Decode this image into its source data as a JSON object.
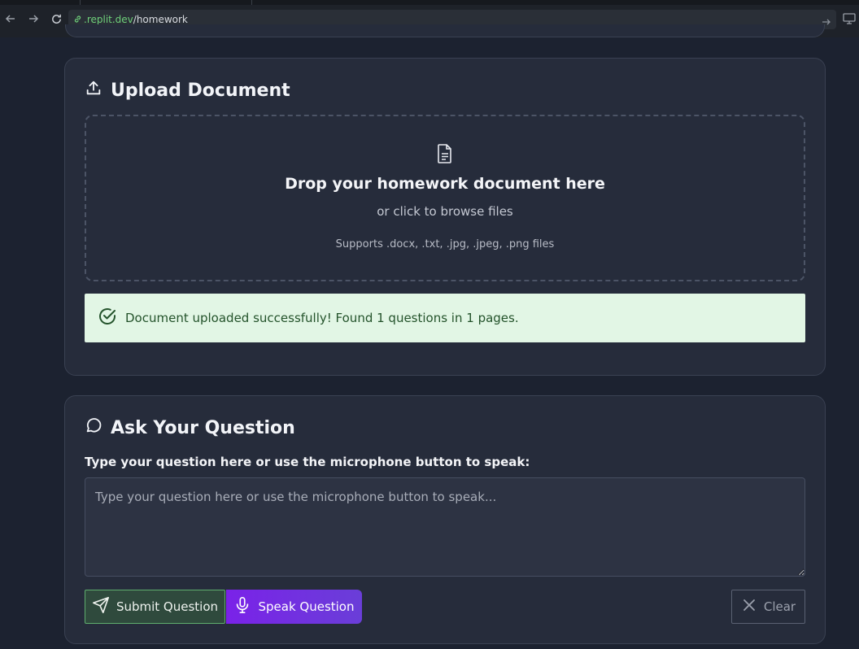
{
  "browser": {
    "url_host": ".replit.dev",
    "url_path": "/homework"
  },
  "upload": {
    "title": "Upload Document",
    "dropzone_title": "Drop your homework document here",
    "dropzone_subtitle": "or click to browse files",
    "dropzone_note": "Supports .docx, .txt, .jpg, .jpeg, .png files",
    "success_message": "Document uploaded successfully! Found 1 questions in 1 pages."
  },
  "ask": {
    "title": "Ask Your Question",
    "label": "Type your question here or use the microphone button to speak:",
    "input_value": "",
    "input_placeholder": "Type your question here or use the microphone button to speak...",
    "submit_label": "Submit Question",
    "speak_label": "Speak Question",
    "clear_label": "Clear"
  },
  "colors": {
    "background": "#1c2230",
    "card": "#262c3b",
    "success_bg": "#e2f6e5",
    "success_text": "#24532b",
    "submit_border": "#5fae6e",
    "speak_gradient_start": "#7a22e8",
    "speak_gradient_end": "#6a3ed8"
  }
}
